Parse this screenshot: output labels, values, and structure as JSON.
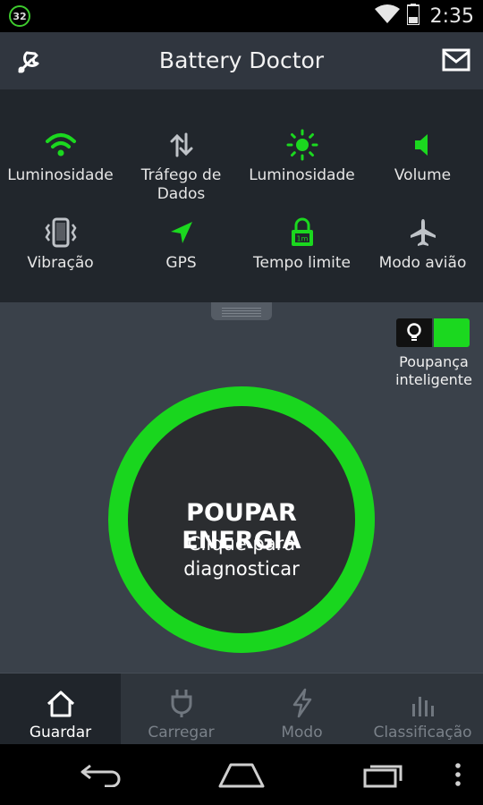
{
  "status_bar": {
    "battery_badge": "32",
    "time": "2:35"
  },
  "app_bar": {
    "title": "Battery Doctor",
    "left_icon": "wrench-icon",
    "right_icon": "mail-icon"
  },
  "quick_settings": [
    {
      "label": "Luminosidade",
      "icon": "wifi-icon",
      "active": true
    },
    {
      "label": "Tráfego de Dados",
      "icon": "data-traffic-icon",
      "active": false
    },
    {
      "label": "Luminosidade",
      "icon": "brightness-icon",
      "active": true
    },
    {
      "label": "Volume",
      "icon": "volume-icon",
      "active": true
    },
    {
      "label": "Vibração",
      "icon": "vibration-icon",
      "active": false
    },
    {
      "label": "GPS",
      "icon": "gps-icon",
      "active": true
    },
    {
      "label": "Tempo limite",
      "icon": "screen-timeout-icon",
      "active": true,
      "badge": "1m"
    },
    {
      "label": "Modo avião",
      "icon": "airplane-icon",
      "active": false
    }
  ],
  "smart_saving": {
    "label_line1": "Poupança",
    "label_line2": "inteligente",
    "enabled": true
  },
  "save_button": {
    "title": "POUPAR ENERGIA",
    "line1": "Clique para",
    "line2": "diagnosticar"
  },
  "tabs": [
    {
      "label": "Guardar",
      "icon": "home-icon",
      "active": true
    },
    {
      "label": "Carregar",
      "icon": "plug-icon",
      "active": false
    },
    {
      "label": "Modo",
      "icon": "lightning-icon",
      "active": false
    },
    {
      "label": "Classificação",
      "icon": "bar-chart-icon",
      "active": false
    }
  ],
  "colors": {
    "accent": "#19d61e",
    "background": "#3a414a",
    "panel": "#21262c",
    "app_bar": "#30363f"
  }
}
